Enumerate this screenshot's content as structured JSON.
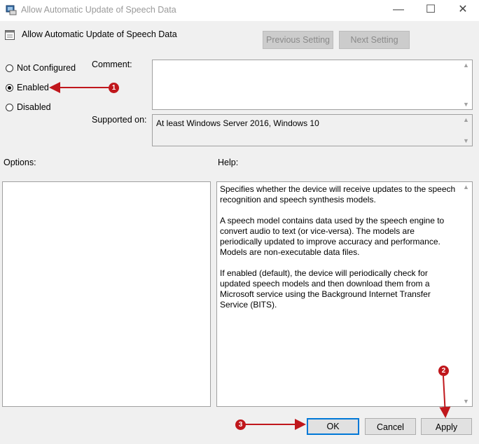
{
  "window": {
    "title": "Allow Automatic Update of Speech Data",
    "controls": {
      "minimize": "—",
      "maximize": "☐",
      "close": "✕"
    }
  },
  "header": {
    "policy_title": "Allow Automatic Update of Speech Data",
    "previous_setting": "Previous Setting",
    "next_setting": "Next Setting"
  },
  "state": {
    "options": [
      {
        "label": "Not Configured",
        "checked": false
      },
      {
        "label": "Enabled",
        "checked": true
      },
      {
        "label": "Disabled",
        "checked": false
      }
    ]
  },
  "comment": {
    "label": "Comment:",
    "value": ""
  },
  "supported": {
    "label": "Supported on:",
    "value": "At least Windows Server 2016, Windows 10"
  },
  "options_panel": {
    "label": "Options:"
  },
  "help_panel": {
    "label": "Help:",
    "paragraphs": [
      "Specifies whether the device will receive updates to the speech recognition and speech synthesis models.",
      "A speech model contains data used by the speech engine to convert audio to text (or vice-versa). The models are periodically updated to improve accuracy and performance. Models are non-executable data files.",
      "If enabled (default), the device will periodically check for updated speech models and then download them from a Microsoft service using the Background Internet Transfer Service (BITS)."
    ]
  },
  "footer": {
    "ok": "OK",
    "cancel": "Cancel",
    "apply": "Apply"
  },
  "annotations": {
    "step1": "1",
    "step2": "2",
    "step3": "3",
    "color": "#c0171c"
  }
}
